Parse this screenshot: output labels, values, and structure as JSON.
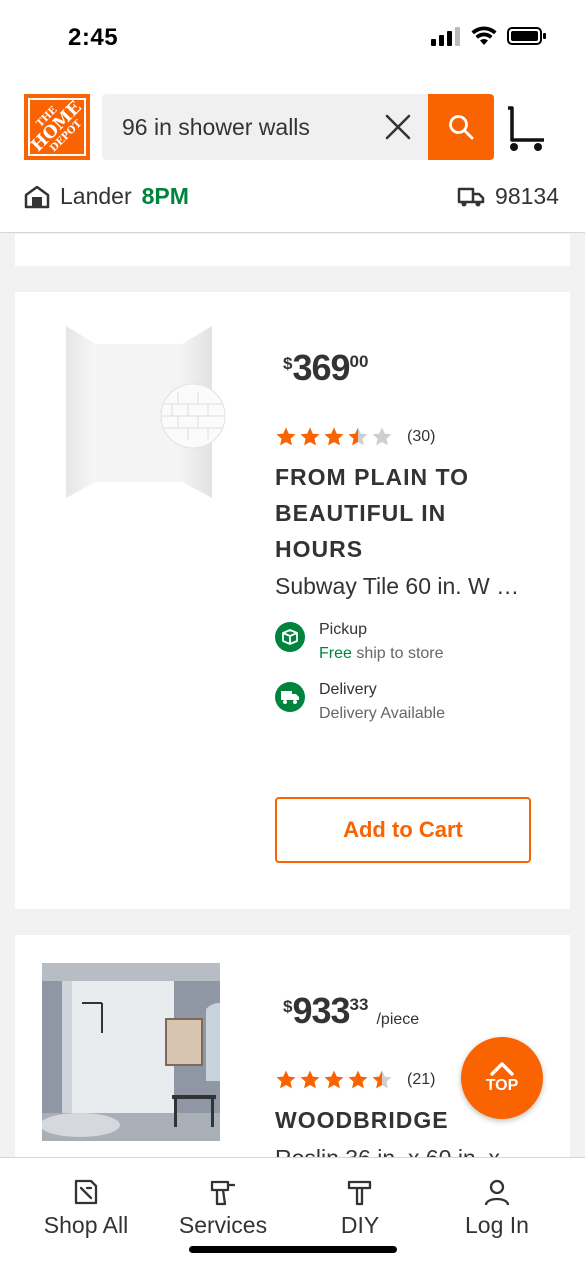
{
  "status": {
    "time": "2:45"
  },
  "header": {
    "logo_line1": "THE",
    "logo_line2": "HOME",
    "logo_line3": "DEPOT",
    "search_value": "96 in shower walls",
    "store_name": "Lander",
    "store_hours": "8PM",
    "zip": "98134"
  },
  "products": [
    {
      "price_symbol": "$",
      "price_whole": "369",
      "price_cents": "00",
      "price_unit": "",
      "rating": 3.5,
      "review_count": "(30)",
      "headline": "FROM PLAIN TO BEAUTIFUL IN HOURS",
      "subtitle": "Subway Tile 60 in. W …",
      "pickup_title": "Pickup",
      "pickup_free": "Free",
      "pickup_rest": " ship to store",
      "delivery_title": "Delivery",
      "delivery_sub": "Delivery Available",
      "add_to_cart": "Add to Cart"
    },
    {
      "price_symbol": "$",
      "price_whole": "933",
      "price_cents": "33",
      "price_unit": "/piece",
      "rating": 4.5,
      "review_count": "(21)",
      "headline": "WOODBRIDGE",
      "subtitle": "Roslin 36 in. x 60 in. x"
    }
  ],
  "top_button": "TOP",
  "nav": {
    "shop_all": "Shop All",
    "services": "Services",
    "diy": "DIY",
    "log_in": "Log In"
  },
  "colors": {
    "brand": "#f96302",
    "green": "#00843d",
    "star": "#f96302"
  }
}
